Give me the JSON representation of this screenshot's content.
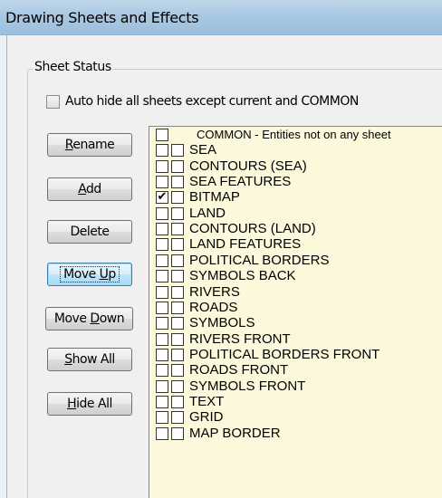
{
  "window": {
    "title": "Drawing Sheets and Effects"
  },
  "sheet_status": {
    "group_label": "Sheet Status",
    "auto_hide_label": "Auto hide all sheets except current and COMMON",
    "auto_hide_checked": false
  },
  "buttons": [
    {
      "mnemonic": "R",
      "rest": "ename"
    },
    {
      "mnemonic": "A",
      "rest": "dd"
    },
    {
      "before": "Delete"
    },
    {
      "before": "Move ",
      "mnemonic": "U",
      "rest": "p"
    },
    {
      "before": "Move ",
      "mnemonic": "D",
      "rest": "own"
    },
    {
      "mnemonic": "S",
      "rest": "how All"
    },
    {
      "mnemonic": "H",
      "rest": "ide All"
    }
  ],
  "sheets": [
    {
      "label": "COMMON - Entities not on any sheet",
      "visible": false,
      "has_second_box": false,
      "second": false
    },
    {
      "label": "SEA",
      "visible": false,
      "has_second_box": true,
      "second": false
    },
    {
      "label": "CONTOURS (SEA)",
      "visible": false,
      "has_second_box": true,
      "second": false
    },
    {
      "label": "SEA FEATURES",
      "visible": false,
      "has_second_box": true,
      "second": false
    },
    {
      "label": "BITMAP",
      "visible": true,
      "has_second_box": true,
      "second": false
    },
    {
      "label": "LAND",
      "visible": false,
      "has_second_box": true,
      "second": false
    },
    {
      "label": "CONTOURS (LAND)",
      "visible": false,
      "has_second_box": true,
      "second": false
    },
    {
      "label": "LAND FEATURES",
      "visible": false,
      "has_second_box": true,
      "second": false
    },
    {
      "label": "POLITICAL BORDERS",
      "visible": false,
      "has_second_box": true,
      "second": false
    },
    {
      "label": "SYMBOLS BACK",
      "visible": false,
      "has_second_box": true,
      "second": false
    },
    {
      "label": "RIVERS",
      "visible": false,
      "has_second_box": true,
      "second": false
    },
    {
      "label": "ROADS",
      "visible": false,
      "has_second_box": true,
      "second": false
    },
    {
      "label": "SYMBOLS",
      "visible": false,
      "has_second_box": true,
      "second": false
    },
    {
      "label": "RIVERS FRONT",
      "visible": false,
      "has_second_box": true,
      "second": false
    },
    {
      "label": "POLITICAL BORDERS FRONT",
      "visible": false,
      "has_second_box": true,
      "second": false
    },
    {
      "label": "ROADS FRONT",
      "visible": false,
      "has_second_box": true,
      "second": false
    },
    {
      "label": "SYMBOLS FRONT",
      "visible": false,
      "has_second_box": true,
      "second": false
    },
    {
      "label": "TEXT",
      "visible": false,
      "has_second_box": true,
      "second": false
    },
    {
      "label": "GRID",
      "visible": false,
      "has_second_box": true,
      "second": false
    },
    {
      "label": "MAP BORDER",
      "visible": false,
      "has_second_box": true,
      "second": false
    }
  ],
  "check_glyph": "✔"
}
